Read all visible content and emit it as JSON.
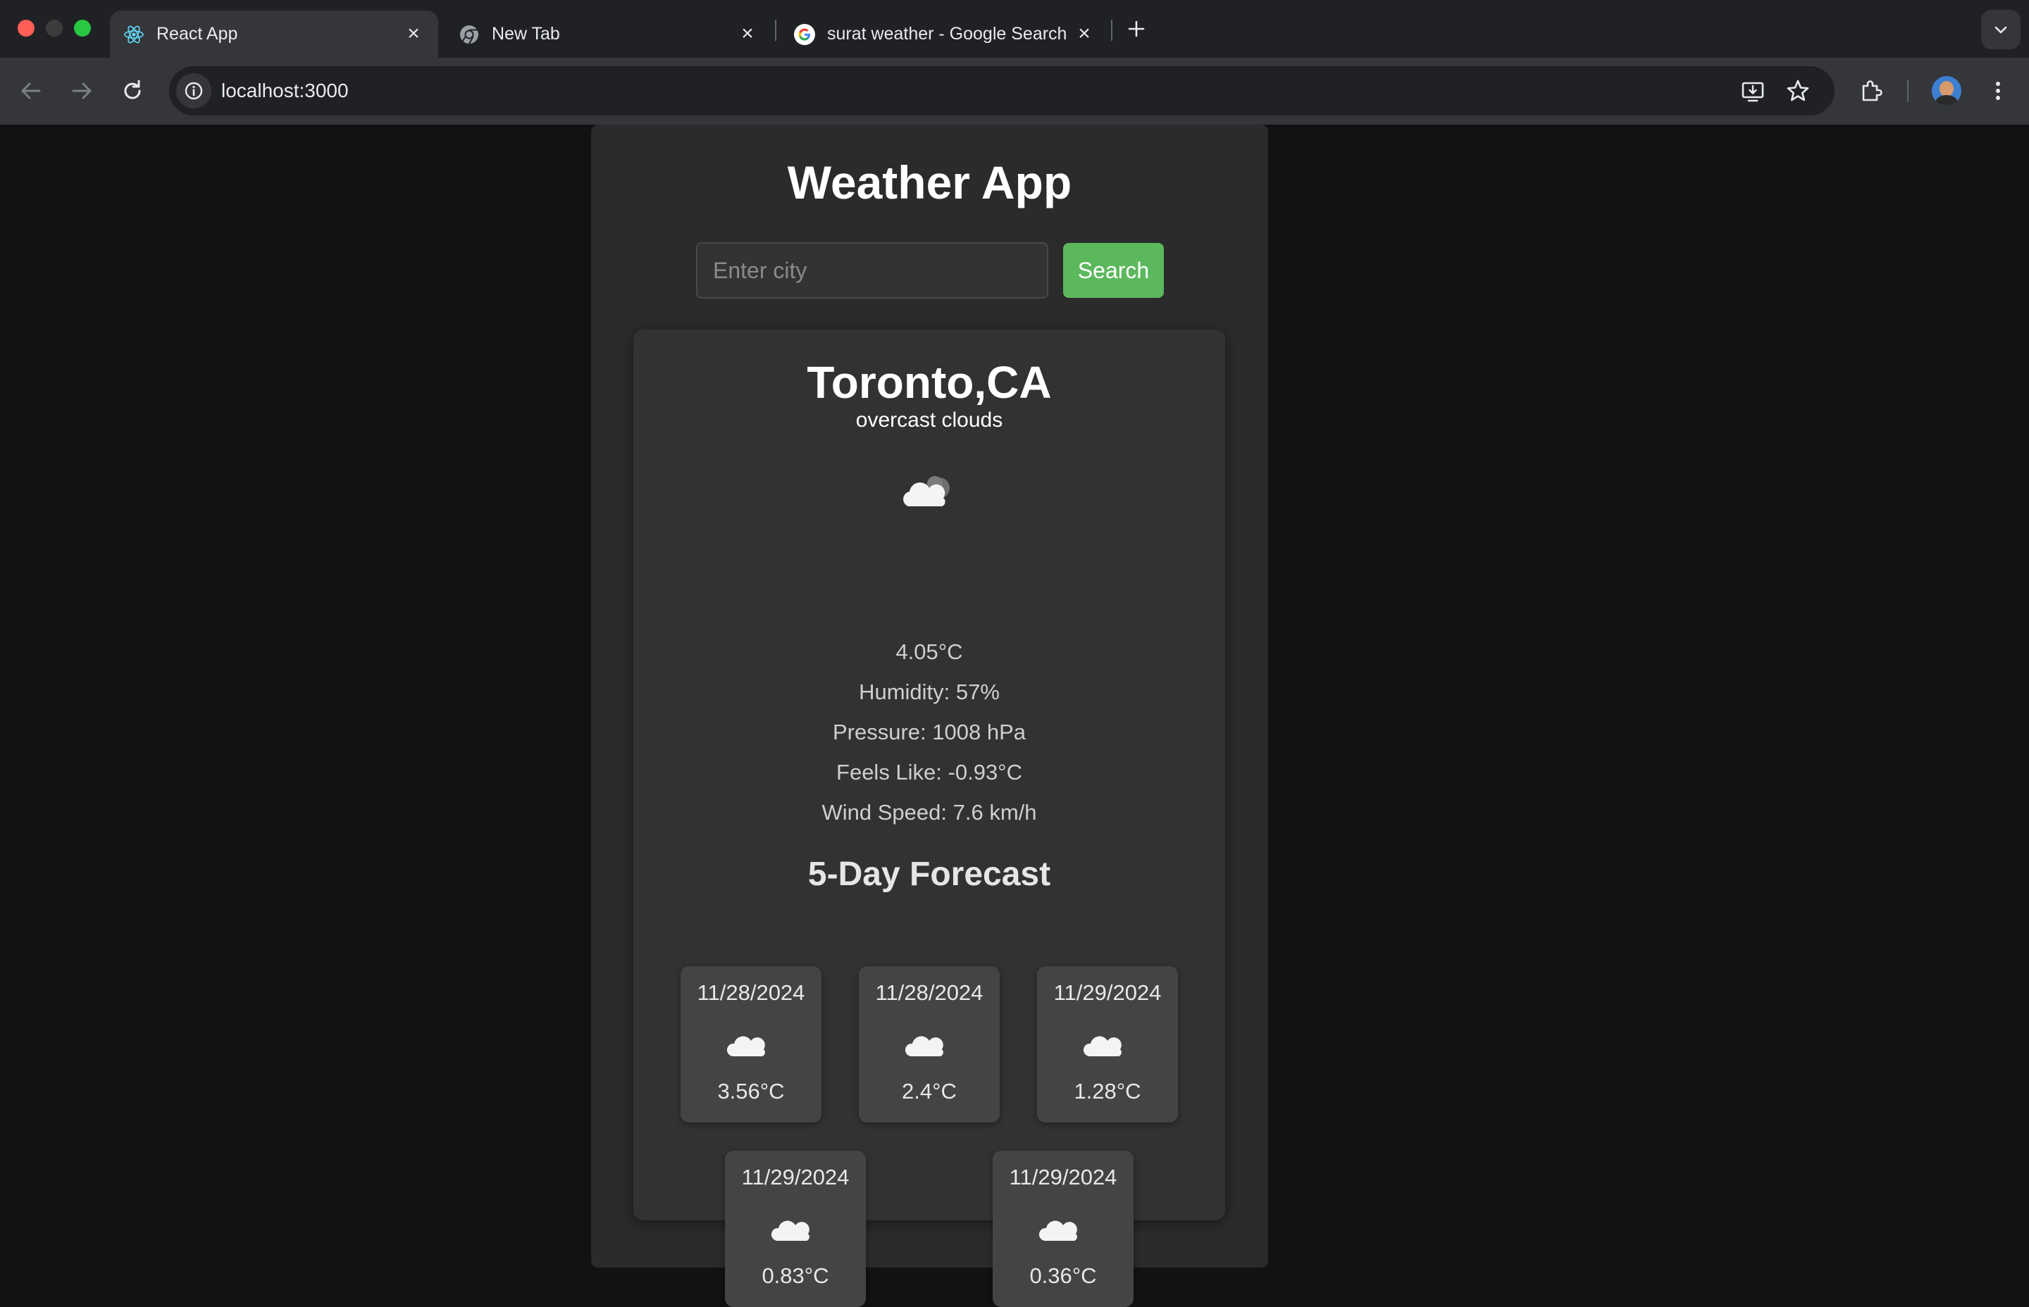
{
  "browser": {
    "tabs": [
      {
        "title": "React App",
        "icon": "react-icon",
        "active": true
      },
      {
        "title": "New Tab",
        "icon": "chrome-icon",
        "active": false
      },
      {
        "title": "surat weather - Google Search",
        "icon": "google-icon",
        "active": false
      }
    ],
    "url": "localhost:3000",
    "colors": {
      "tabbar": "#202124",
      "toolbar": "#35363a",
      "close": "#ff5f57",
      "minimize": "#3c3c3c",
      "maximize": "#28c840"
    }
  },
  "app": {
    "title": "Weather App",
    "search": {
      "placeholder": "Enter city",
      "value": "",
      "button_label": "Search"
    },
    "accent": "#5cb85c"
  },
  "current": {
    "city": "Toronto,CA",
    "description": "overcast clouds",
    "icon": "cloud-icon",
    "temperature": "4.05°C",
    "humidity": "Humidity: 57%",
    "pressure": "Pressure: 1008 hPa",
    "feels_like": "Feels Like: -0.93°C",
    "wind_speed": "Wind Speed: 7.6 km/h"
  },
  "forecast": {
    "title": "5-Day Forecast",
    "items": [
      {
        "date": "11/28/2024",
        "icon": "cloud-icon",
        "temp": "3.56°C"
      },
      {
        "date": "11/28/2024",
        "icon": "cloud-icon",
        "temp": "2.4°C"
      },
      {
        "date": "11/29/2024",
        "icon": "cloud-icon",
        "temp": "1.28°C"
      },
      {
        "date": "11/29/2024",
        "icon": "cloud-icon",
        "temp": "0.83°C"
      },
      {
        "date": "11/29/2024",
        "icon": "cloud-icon",
        "temp": "0.36°C"
      }
    ]
  }
}
